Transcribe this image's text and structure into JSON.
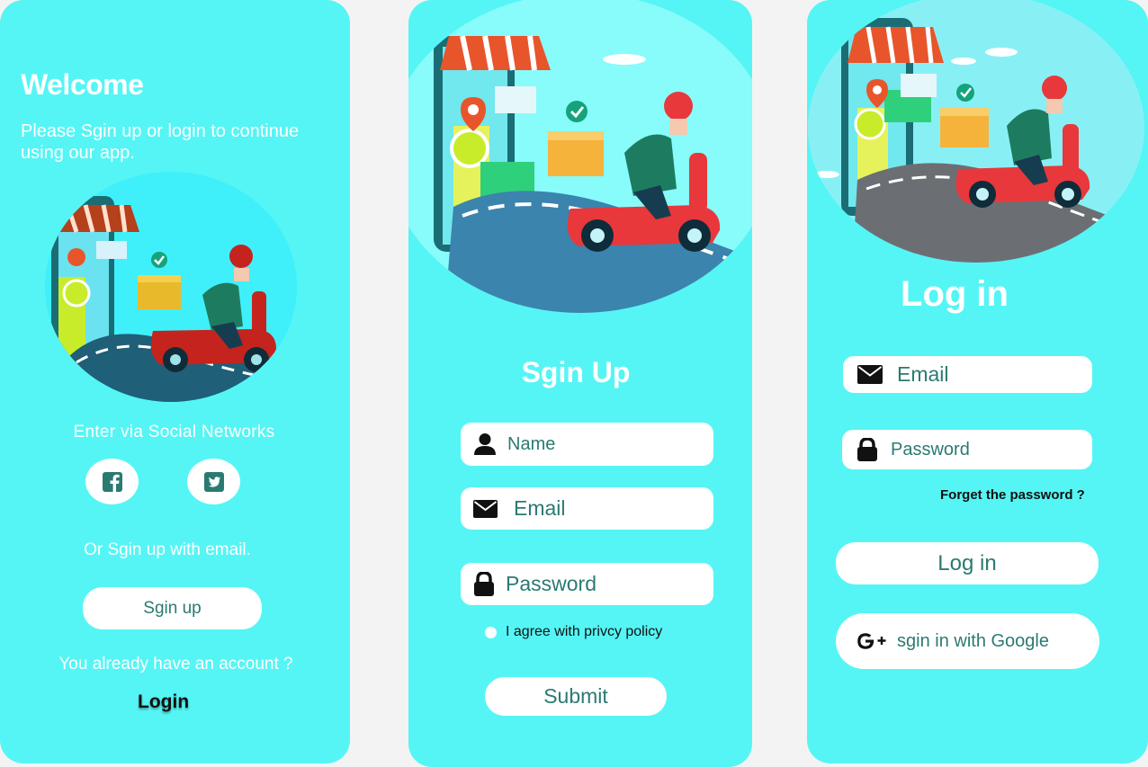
{
  "colors": {
    "panel": "#55f5f5",
    "accent_text": "#2b7a72",
    "white": "#ffffff",
    "icon_dark": "#111111",
    "scooter_red": "#e8383b",
    "box_orange": "#f5b33b"
  },
  "welcome": {
    "title": "Welcome",
    "subtitle_line1": "Please Sgin up or login to continue",
    "subtitle_line2": "using our app.",
    "social_label": "Enter via Social Networks",
    "social_icons": [
      "facebook-icon",
      "twitter-icon"
    ],
    "email_label": "Or Sgin up with email.",
    "signup_button": "Sgin up",
    "account_text": "You already have an account ?",
    "login_link": "Login"
  },
  "signup": {
    "title": "Sgin Up",
    "name_placeholder": "Name",
    "email_placeholder": "Email",
    "password_placeholder": "Password",
    "agree_text": "I agree with privcy policy",
    "submit_button": "Submit"
  },
  "login": {
    "title": "Log in",
    "email_placeholder": "Email",
    "password_placeholder": "Password",
    "forgot_link": "Forget the password ?",
    "login_button": "Log in",
    "google_button": "sgin in with Google"
  }
}
